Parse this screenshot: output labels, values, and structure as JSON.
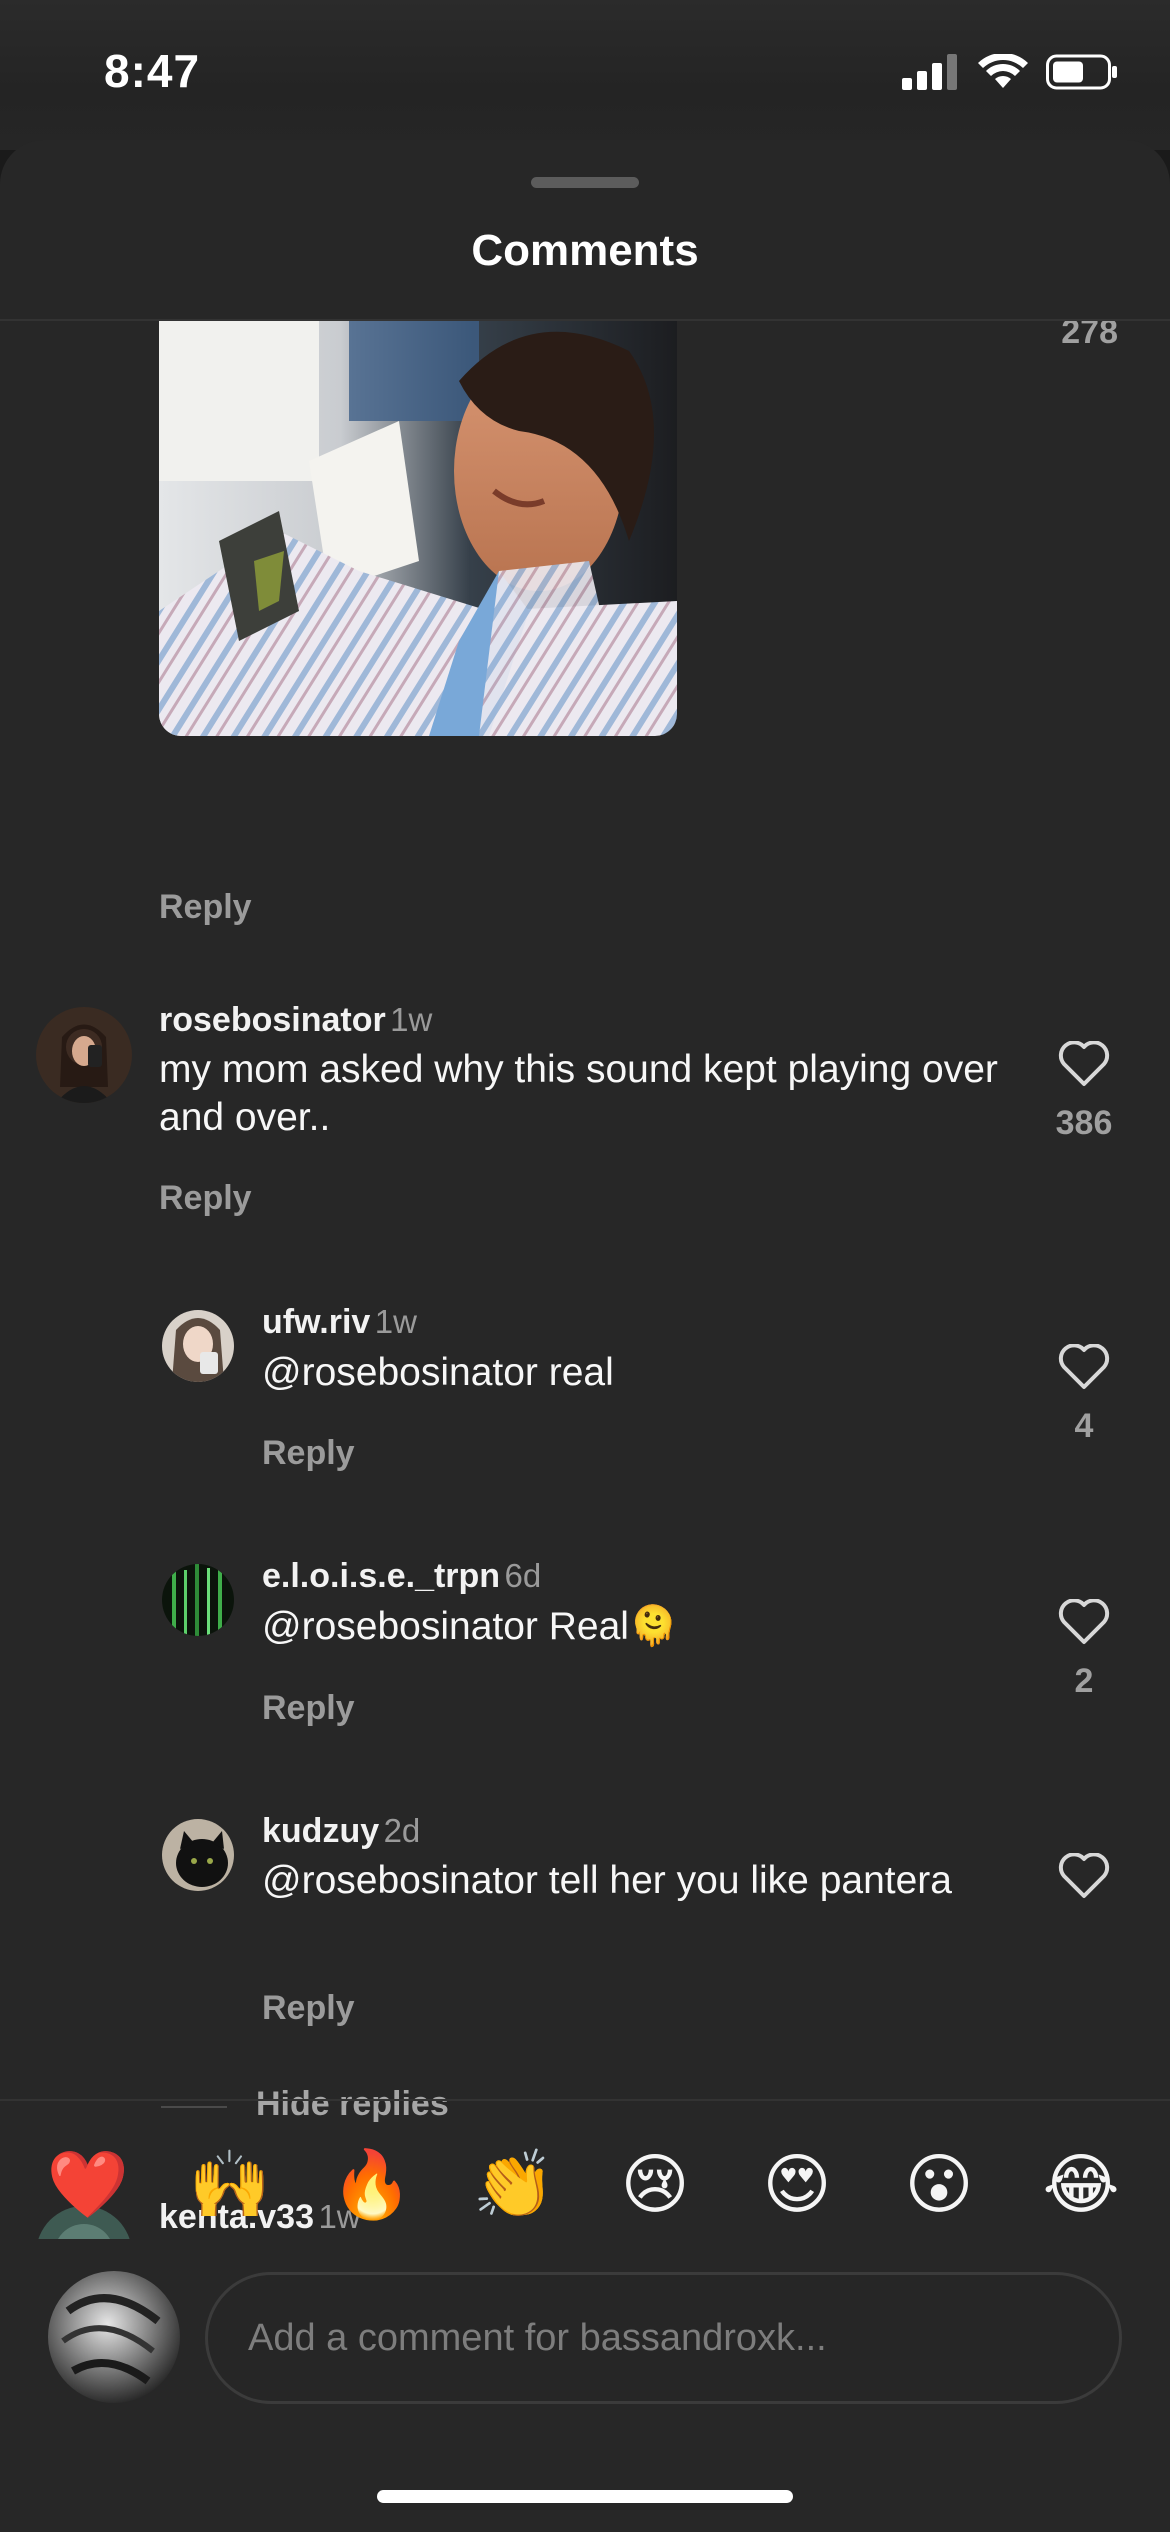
{
  "status": {
    "time": "8:47"
  },
  "sheet": {
    "title": "Comments"
  },
  "previous_comment": {
    "like_count": "278",
    "reply_label": "Reply"
  },
  "comments": [
    {
      "user": "rosebosinator",
      "ago": "1w",
      "text": "my mom asked why this sound kept playing over and over..",
      "likes": "386",
      "reply_label": "Reply"
    }
  ],
  "replies": [
    {
      "user": "ufw.riv",
      "ago": "1w",
      "text": "@rosebosinator real",
      "likes": "4",
      "reply_label": "Reply"
    },
    {
      "user": "e.l.o.i.s.e._trpn",
      "ago": "6d",
      "text": "@rosebosinator Real",
      "emoji": "🫠",
      "likes": "2",
      "reply_label": "Reply"
    },
    {
      "user": "kudzuy",
      "ago": "2d",
      "text": "@rosebosinator tell her you like pantera",
      "likes": "",
      "reply_label": "Reply"
    }
  ],
  "hide_replies_label": "Hide replies",
  "next_comment": {
    "user": "kenta.v33",
    "ago": "1w"
  },
  "emoji_bar": [
    "❤️",
    "🙌",
    "🔥",
    "👏",
    "😢",
    "😍",
    "😮",
    "😂"
  ],
  "composer": {
    "placeholder": "Add a comment for bassandroxk..."
  },
  "colors": {
    "background": "#272727",
    "text": "#f5f5f5",
    "muted": "#9b9b9b"
  }
}
